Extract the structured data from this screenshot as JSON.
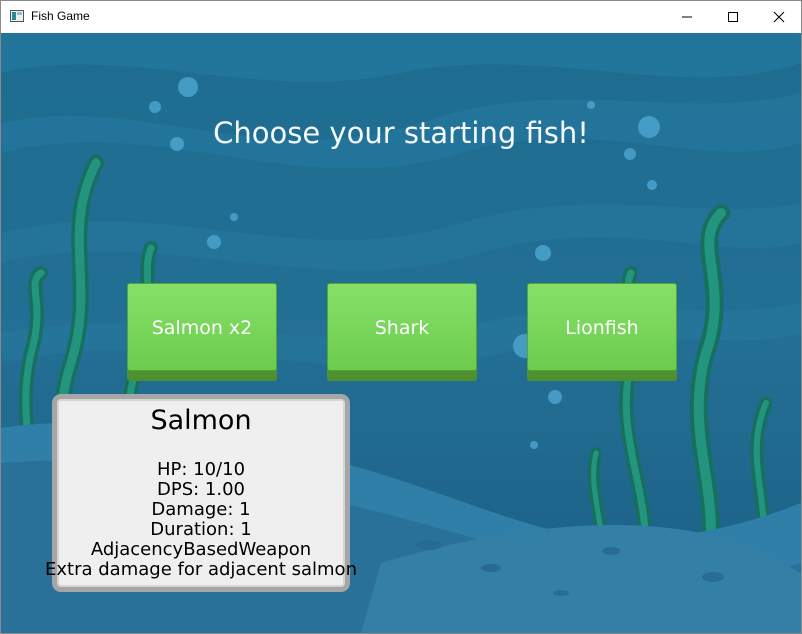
{
  "window": {
    "title": "Fish Game",
    "controls": [
      "minimize",
      "maximize",
      "close"
    ]
  },
  "game": {
    "heading": "Choose your starting fish!",
    "fish_options": [
      {
        "label": "Salmon x2"
      },
      {
        "label": "Shark"
      },
      {
        "label": "Lionfish"
      }
    ],
    "tooltip": {
      "title": "Salmon",
      "hp": "HP: 10/10",
      "dps": "DPS: 1.00",
      "damage": "Damage: 1",
      "duration": "Duration: 1",
      "weapon_type": "AdjacencyBasedWeapon",
      "description": "Extra damage for adjacent salmon"
    }
  },
  "colors": {
    "button_green": "#78d65a",
    "button_base": "#4e8f30",
    "water_dark": "#1e6f92",
    "water_light": "#2e8ab4",
    "seaweed": "#1c8a78",
    "tooltip_bg": "#efefef",
    "tooltip_border": "#a6a6a6"
  }
}
